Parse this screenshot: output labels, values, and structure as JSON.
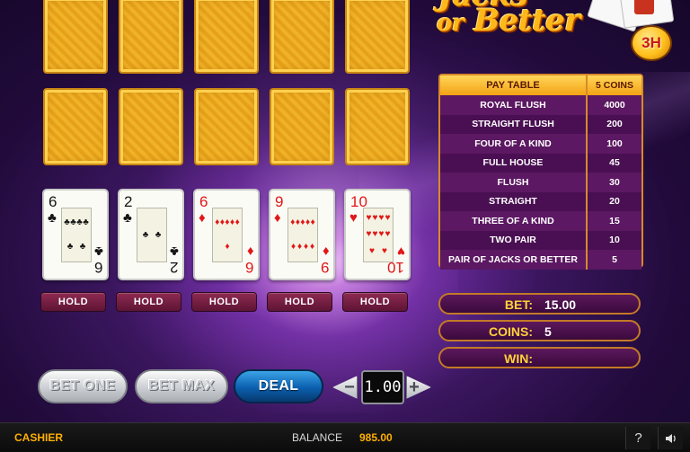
{
  "game": {
    "title_line1": "Jacks",
    "title_or": "or",
    "title_line2": "Better",
    "badge": "3H"
  },
  "paytable": {
    "header_name": "PAY TABLE",
    "header_coins": "5 COINS",
    "rows": [
      {
        "name": "ROYAL FLUSH",
        "value": "4000"
      },
      {
        "name": "STRAIGHT FLUSH",
        "value": "200"
      },
      {
        "name": "FOUR OF A KIND",
        "value": "100"
      },
      {
        "name": "FULL HOUSE",
        "value": "45"
      },
      {
        "name": "FLUSH",
        "value": "30"
      },
      {
        "name": "STRAIGHT",
        "value": "20"
      },
      {
        "name": "THREE OF A KIND",
        "value": "15"
      },
      {
        "name": "TWO PAIR",
        "value": "10"
      },
      {
        "name": "PAIR OF  JACKS OR BETTER",
        "value": "5"
      }
    ]
  },
  "hand": [
    {
      "rank": "6",
      "suit": "♣",
      "color": "#151515"
    },
    {
      "rank": "2",
      "suit": "♣",
      "color": "#151515"
    },
    {
      "rank": "6",
      "suit": "♦",
      "color": "#e01818"
    },
    {
      "rank": "9",
      "suit": "♦",
      "color": "#e01818"
    },
    {
      "rank": "10",
      "suit": "♥",
      "color": "#e01818"
    }
  ],
  "hold_label": "HOLD",
  "info": {
    "bet_label": "BET:",
    "bet_value": "15.00",
    "coins_label": "COINS:",
    "coins_value": "5",
    "win_label": "WIN:",
    "win_value": ""
  },
  "controls": {
    "bet_one": "BET ONE",
    "bet_max": "BET MAX",
    "deal": "DEAL",
    "minus": "−",
    "plus": "+",
    "coin_value": "1.00"
  },
  "footer": {
    "cashier": "CASHIER",
    "balance_label": "BALANCE",
    "balance_value": "985.00",
    "help": "?",
    "sound_icon": "speaker-icon"
  },
  "colors": {
    "accent_gold": "#ffb000",
    "table_purple": "#4e1256",
    "deal_blue": "#0b5fae"
  }
}
